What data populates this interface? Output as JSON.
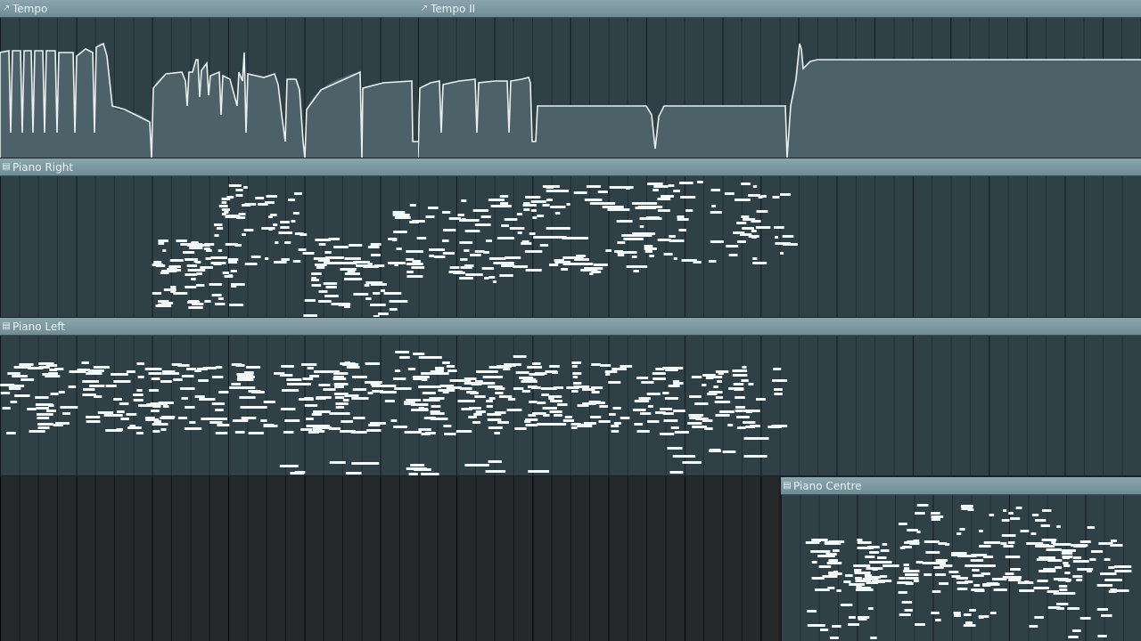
{
  "tracks": {
    "tempo": {
      "title": "Tempo",
      "icon": "automation-icon"
    },
    "tempo_ii": {
      "title": "Tempo II",
      "icon": "automation-icon"
    },
    "piano_right": {
      "title": "Piano Right",
      "icon": "piano-roll-icon"
    },
    "piano_left": {
      "title": "Piano Left",
      "icon": "piano-roll-icon"
    },
    "piano_centre": {
      "title": "Piano Centre",
      "icon": "piano-roll-icon"
    }
  },
  "colors": {
    "clip_body": "#2f4047",
    "clip_header": "#7b98a1",
    "note": "#f2f7f8",
    "automation_fill": "#4d6268",
    "automation_line": "#e9eef0",
    "empty_track": "#25292c"
  }
}
